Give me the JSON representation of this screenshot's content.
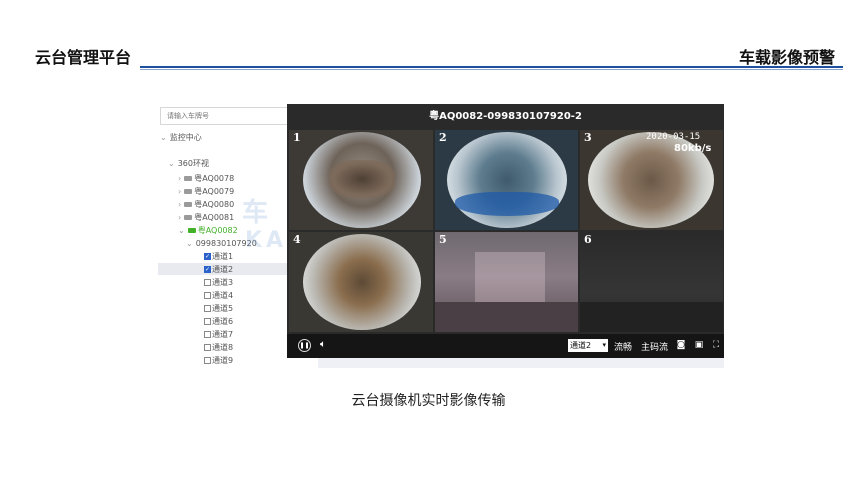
{
  "header": {
    "left_title": "云台管理平台",
    "right_title": "车载影像预警"
  },
  "caption": "云台摄像机实时影像传输",
  "sidebar": {
    "search_placeholder": "请输入车牌号",
    "root": "监控中心",
    "group": "360环视",
    "vehicles": [
      "粤AQ0078",
      "粤AQ0079",
      "粤AQ0080",
      "粤AQ0081",
      "粤AQ0082"
    ],
    "device": "099830107920",
    "channels": [
      {
        "label": "通道1",
        "checked": true
      },
      {
        "label": "通道2",
        "checked": true
      },
      {
        "label": "通道3",
        "checked": false
      },
      {
        "label": "通道4",
        "checked": false
      },
      {
        "label": "通道5",
        "checked": false
      },
      {
        "label": "通道6",
        "checked": false
      },
      {
        "label": "通道7",
        "checked": false
      },
      {
        "label": "通道8",
        "checked": false
      },
      {
        "label": "通道9",
        "checked": false
      }
    ]
  },
  "watermark": {
    "line1": "车",
    "line2": "KA  BER"
  },
  "player": {
    "title": "粤AQ0082-099830107920-2",
    "cells": [
      "1",
      "2",
      "3",
      "4",
      "5",
      "6"
    ],
    "overlay_date": "2020-03-15",
    "overlay_rate": "80kb/s",
    "channel_select": "通道2",
    "fluency": "流畅",
    "main_stream": "主码流"
  },
  "icons": [
    "pause-icon",
    "volume-icon",
    "dropdown-arrow-icon",
    "camera-icon",
    "record-icon",
    "fullscreen-icon"
  ]
}
